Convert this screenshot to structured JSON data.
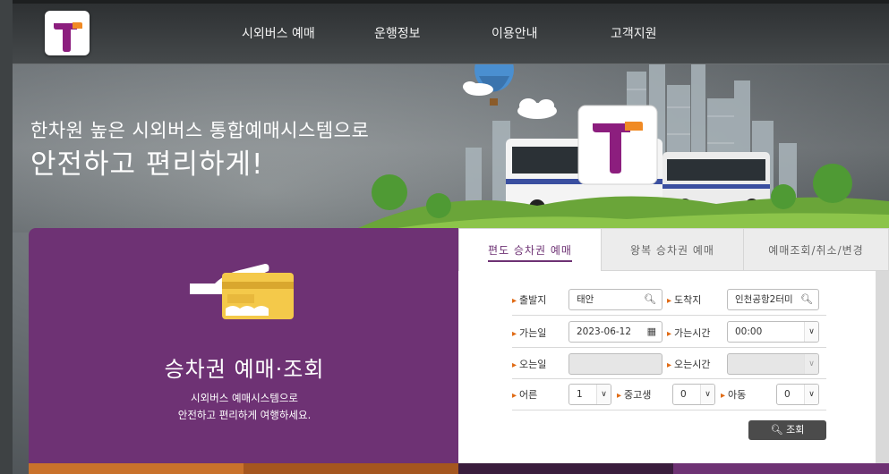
{
  "brand": {
    "logo_letter": "T",
    "purple": "#6e3274",
    "orange": "#f08a24"
  },
  "nav": {
    "items": [
      "시외버스 예매",
      "운행정보",
      "이용안내",
      "고객지원"
    ]
  },
  "hero": {
    "slogan_line1": "한차원 높은 시외버스 통합예매시스템으로",
    "slogan_line2": "안전하고 편리하게!"
  },
  "card": {
    "title": "승차권 예매·조회",
    "sub_line1": "시외버스 예매시스템으로",
    "sub_line2": "안전하고 편리하게 여행하세요."
  },
  "tabs": [
    "편도 승차권 예매",
    "왕복 승차권 예매",
    "예매조회/취소/변경"
  ],
  "form": {
    "departure_label": "출발지",
    "departure_value": "태안",
    "arrival_label": "도착지",
    "arrival_value": "인천공항2터미",
    "go_date_label": "가는일",
    "go_date_value": "2023-06-12",
    "go_time_label": "가는시간",
    "go_time_value": "00:00",
    "return_date_label": "오는일",
    "return_date_value": "",
    "return_time_label": "오는시간",
    "return_time_value": "",
    "adult_label": "어른",
    "adult_value": "1",
    "teen_label": "중고생",
    "teen_value": "0",
    "child_label": "아동",
    "child_value": "0",
    "search_button": "조회"
  }
}
